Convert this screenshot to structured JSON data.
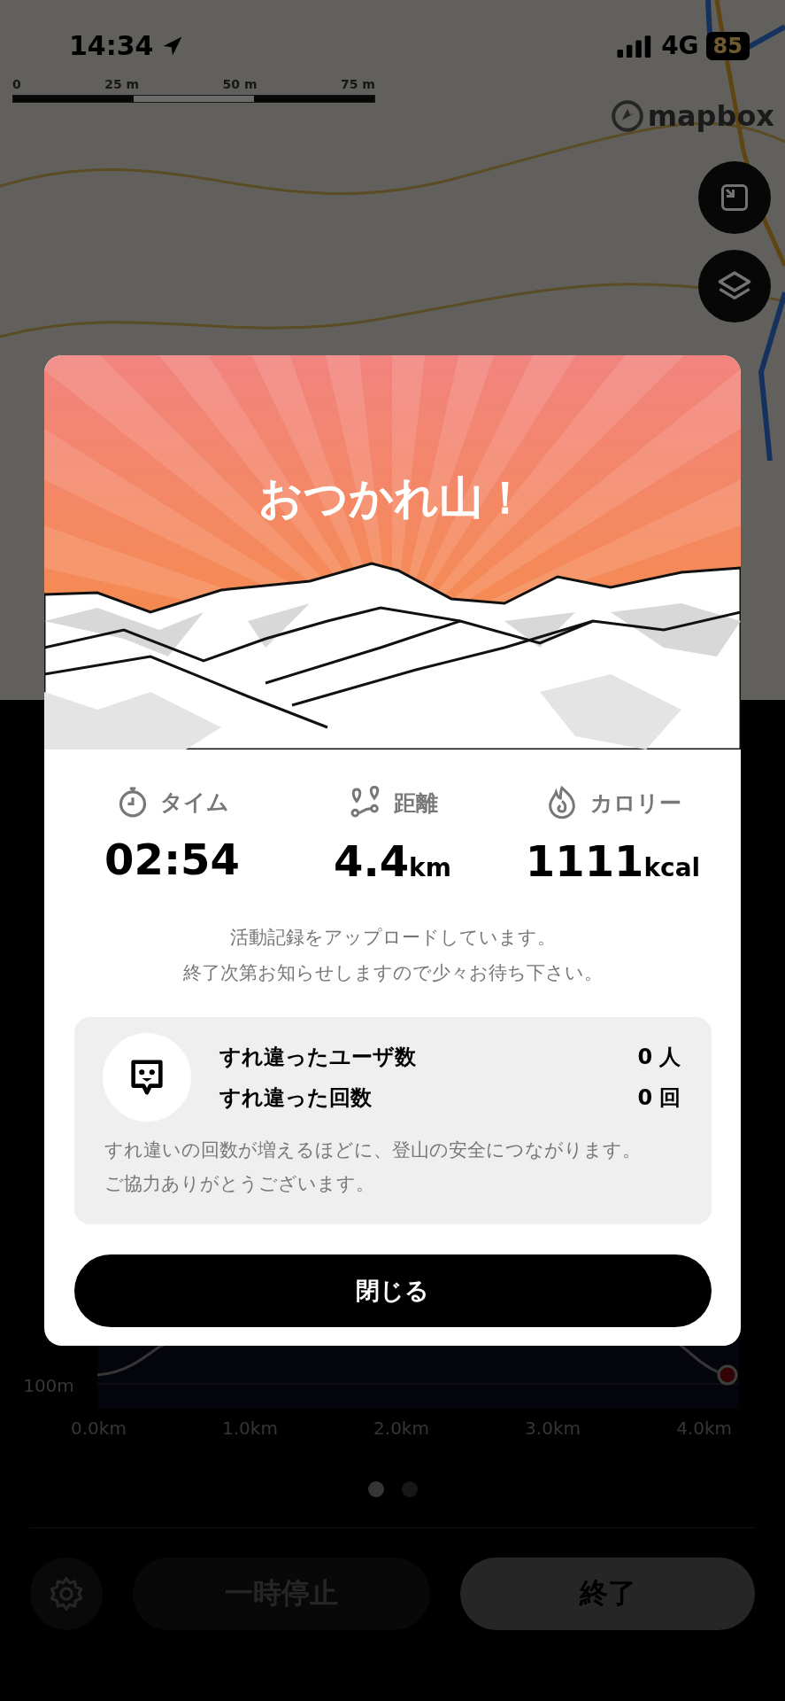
{
  "status_bar": {
    "time": "14:34",
    "network": "4G",
    "battery": "85"
  },
  "map": {
    "scale_labels": [
      "0",
      "25 m",
      "50 m",
      "75 m"
    ],
    "attribution": "mapbox"
  },
  "chart": {
    "y_label": "100m",
    "x_labels": [
      "0.0km",
      "1.0km",
      "2.0km",
      "3.0km",
      "4.0km"
    ]
  },
  "pager": [
    {
      "selected": true
    },
    {
      "selected": false
    }
  ],
  "controls": {
    "pause": "一時停止",
    "finish": "終了"
  },
  "dialog": {
    "title": "おつかれ山！",
    "stats": [
      {
        "kind": "time",
        "label": "タイム",
        "value": "02:54"
      },
      {
        "kind": "distance",
        "label": "距離",
        "value": "4.4",
        "unit": "km"
      },
      {
        "kind": "calories",
        "label": "カロリー",
        "value": "1111",
        "unit": "kcal"
      }
    ],
    "message": [
      "活動記録をアップロードしています。",
      "終了次第お知らせしますので少々お待ち下さい。"
    ],
    "encounters": {
      "rows": [
        {
          "label": "すれ違ったユーザ数",
          "value": "0",
          "unit": "人"
        },
        {
          "label": "すれ違った回数",
          "value": "0",
          "unit": "回"
        }
      ],
      "note": [
        "すれ違いの回数が増えるほどに、登山の安全につながります。",
        "ご協力ありがとうございます。"
      ]
    },
    "close_button": "閉じる"
  }
}
